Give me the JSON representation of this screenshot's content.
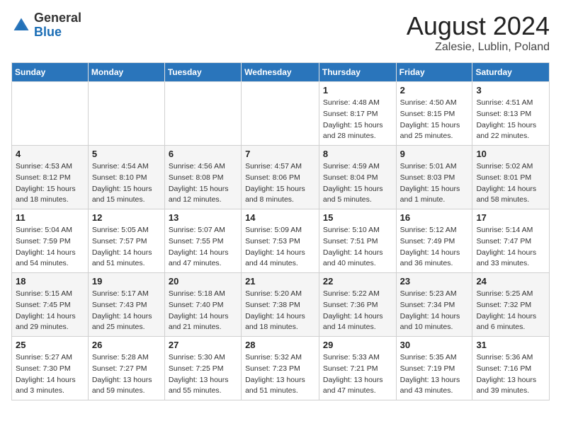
{
  "header": {
    "logo_general": "General",
    "logo_blue": "Blue",
    "title": "August 2024",
    "location": "Zalesie, Lublin, Poland"
  },
  "days_of_week": [
    "Sunday",
    "Monday",
    "Tuesday",
    "Wednesday",
    "Thursday",
    "Friday",
    "Saturday"
  ],
  "weeks": [
    [
      {
        "day": "",
        "detail": ""
      },
      {
        "day": "",
        "detail": ""
      },
      {
        "day": "",
        "detail": ""
      },
      {
        "day": "",
        "detail": ""
      },
      {
        "day": "1",
        "detail": "Sunrise: 4:48 AM\nSunset: 8:17 PM\nDaylight: 15 hours\nand 28 minutes."
      },
      {
        "day": "2",
        "detail": "Sunrise: 4:50 AM\nSunset: 8:15 PM\nDaylight: 15 hours\nand 25 minutes."
      },
      {
        "day": "3",
        "detail": "Sunrise: 4:51 AM\nSunset: 8:13 PM\nDaylight: 15 hours\nand 22 minutes."
      }
    ],
    [
      {
        "day": "4",
        "detail": "Sunrise: 4:53 AM\nSunset: 8:12 PM\nDaylight: 15 hours\nand 18 minutes."
      },
      {
        "day": "5",
        "detail": "Sunrise: 4:54 AM\nSunset: 8:10 PM\nDaylight: 15 hours\nand 15 minutes."
      },
      {
        "day": "6",
        "detail": "Sunrise: 4:56 AM\nSunset: 8:08 PM\nDaylight: 15 hours\nand 12 minutes."
      },
      {
        "day": "7",
        "detail": "Sunrise: 4:57 AM\nSunset: 8:06 PM\nDaylight: 15 hours\nand 8 minutes."
      },
      {
        "day": "8",
        "detail": "Sunrise: 4:59 AM\nSunset: 8:04 PM\nDaylight: 15 hours\nand 5 minutes."
      },
      {
        "day": "9",
        "detail": "Sunrise: 5:01 AM\nSunset: 8:03 PM\nDaylight: 15 hours\nand 1 minute."
      },
      {
        "day": "10",
        "detail": "Sunrise: 5:02 AM\nSunset: 8:01 PM\nDaylight: 14 hours\nand 58 minutes."
      }
    ],
    [
      {
        "day": "11",
        "detail": "Sunrise: 5:04 AM\nSunset: 7:59 PM\nDaylight: 14 hours\nand 54 minutes."
      },
      {
        "day": "12",
        "detail": "Sunrise: 5:05 AM\nSunset: 7:57 PM\nDaylight: 14 hours\nand 51 minutes."
      },
      {
        "day": "13",
        "detail": "Sunrise: 5:07 AM\nSunset: 7:55 PM\nDaylight: 14 hours\nand 47 minutes."
      },
      {
        "day": "14",
        "detail": "Sunrise: 5:09 AM\nSunset: 7:53 PM\nDaylight: 14 hours\nand 44 minutes."
      },
      {
        "day": "15",
        "detail": "Sunrise: 5:10 AM\nSunset: 7:51 PM\nDaylight: 14 hours\nand 40 minutes."
      },
      {
        "day": "16",
        "detail": "Sunrise: 5:12 AM\nSunset: 7:49 PM\nDaylight: 14 hours\nand 36 minutes."
      },
      {
        "day": "17",
        "detail": "Sunrise: 5:14 AM\nSunset: 7:47 PM\nDaylight: 14 hours\nand 33 minutes."
      }
    ],
    [
      {
        "day": "18",
        "detail": "Sunrise: 5:15 AM\nSunset: 7:45 PM\nDaylight: 14 hours\nand 29 minutes."
      },
      {
        "day": "19",
        "detail": "Sunrise: 5:17 AM\nSunset: 7:43 PM\nDaylight: 14 hours\nand 25 minutes."
      },
      {
        "day": "20",
        "detail": "Sunrise: 5:18 AM\nSunset: 7:40 PM\nDaylight: 14 hours\nand 21 minutes."
      },
      {
        "day": "21",
        "detail": "Sunrise: 5:20 AM\nSunset: 7:38 PM\nDaylight: 14 hours\nand 18 minutes."
      },
      {
        "day": "22",
        "detail": "Sunrise: 5:22 AM\nSunset: 7:36 PM\nDaylight: 14 hours\nand 14 minutes."
      },
      {
        "day": "23",
        "detail": "Sunrise: 5:23 AM\nSunset: 7:34 PM\nDaylight: 14 hours\nand 10 minutes."
      },
      {
        "day": "24",
        "detail": "Sunrise: 5:25 AM\nSunset: 7:32 PM\nDaylight: 14 hours\nand 6 minutes."
      }
    ],
    [
      {
        "day": "25",
        "detail": "Sunrise: 5:27 AM\nSunset: 7:30 PM\nDaylight: 14 hours\nand 3 minutes."
      },
      {
        "day": "26",
        "detail": "Sunrise: 5:28 AM\nSunset: 7:27 PM\nDaylight: 13 hours\nand 59 minutes."
      },
      {
        "day": "27",
        "detail": "Sunrise: 5:30 AM\nSunset: 7:25 PM\nDaylight: 13 hours\nand 55 minutes."
      },
      {
        "day": "28",
        "detail": "Sunrise: 5:32 AM\nSunset: 7:23 PM\nDaylight: 13 hours\nand 51 minutes."
      },
      {
        "day": "29",
        "detail": "Sunrise: 5:33 AM\nSunset: 7:21 PM\nDaylight: 13 hours\nand 47 minutes."
      },
      {
        "day": "30",
        "detail": "Sunrise: 5:35 AM\nSunset: 7:19 PM\nDaylight: 13 hours\nand 43 minutes."
      },
      {
        "day": "31",
        "detail": "Sunrise: 5:36 AM\nSunset: 7:16 PM\nDaylight: 13 hours\nand 39 minutes."
      }
    ]
  ]
}
